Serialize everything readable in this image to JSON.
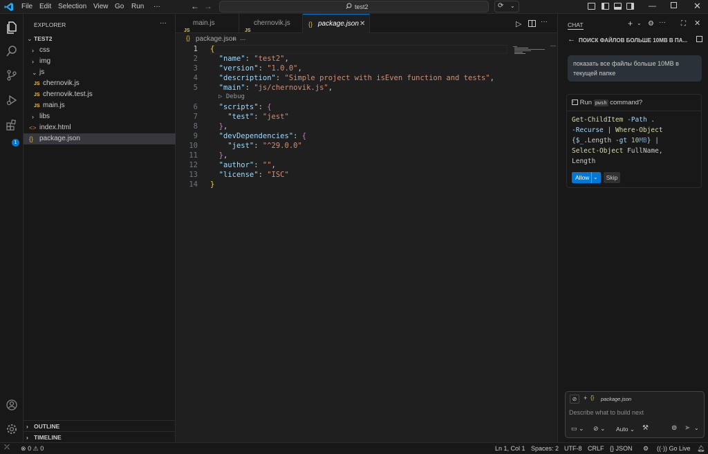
{
  "menu": [
    "File",
    "Edit",
    "Selection",
    "View",
    "Go",
    "Run",
    "···"
  ],
  "search": {
    "label": "test2"
  },
  "explorer": {
    "title": "EXPLORER",
    "folder": "TEST2",
    "items": [
      {
        "label": "css",
        "kind": "folder"
      },
      {
        "label": "img",
        "kind": "folder"
      },
      {
        "label": "js",
        "kind": "folder-open"
      },
      {
        "label": "chernovik.js",
        "kind": "js"
      },
      {
        "label": "chernovik.test.js",
        "kind": "js"
      },
      {
        "label": "main.js",
        "kind": "js"
      },
      {
        "label": "libs",
        "kind": "folder"
      },
      {
        "label": "index.html",
        "kind": "html"
      },
      {
        "label": "package.json",
        "kind": "json",
        "selected": true
      }
    ],
    "outline": "OUTLINE",
    "timeline": "TIMELINE"
  },
  "tabs": [
    {
      "label": "main.js",
      "icon": "JS"
    },
    {
      "label": "chernovik.js",
      "icon": "JS"
    },
    {
      "label": "package.json",
      "icon": "{}",
      "active": true
    }
  ],
  "breadcrumb": {
    "file": "package.json",
    "rest": "..."
  },
  "editor": {
    "debug_lens": "Debug",
    "lines": [
      {
        "n": "1",
        "t": "{"
      },
      {
        "n": "2",
        "t": "  \"name\": \"test2\","
      },
      {
        "n": "3",
        "t": "  \"version\": \"1.0.0\","
      },
      {
        "n": "4",
        "t": "  \"description\": \"Simple project with isEven function and tests\","
      },
      {
        "n": "5",
        "t": "  \"main\": \"js/chernovik.js\","
      },
      {
        "n": "6",
        "t": "  \"scripts\": {"
      },
      {
        "n": "7",
        "t": "    \"test\": \"jest\""
      },
      {
        "n": "8",
        "t": "  },"
      },
      {
        "n": "9",
        "t": "  \"devDependencies\": {"
      },
      {
        "n": "10",
        "t": "    \"jest\": \"^29.0.0\""
      },
      {
        "n": "11",
        "t": "  },"
      },
      {
        "n": "12",
        "t": "  \"author\": \"\","
      },
      {
        "n": "13",
        "t": "  \"license\": \"ISC\""
      },
      {
        "n": "14",
        "t": "}"
      }
    ]
  },
  "chat": {
    "title": "CHAT",
    "conversation": "ПОИСК ФАЙЛОВ БОЛЬШЕ 10MB В ПА...",
    "user_message": "показать все файлы больше 10MB в текущей папке",
    "run_prefix": "Run",
    "run_shell": "pwsh",
    "run_suffix": "command?",
    "allow_label": "Allow",
    "skip_label": "Skip",
    "context_file": "package.json",
    "input_placeholder": "Describe what to build next",
    "mode_label": "Auto"
  },
  "status": {
    "errors": "0",
    "warnings": "0",
    "position": "Ln 1, Col 1",
    "spaces": "Spaces: 2",
    "encoding": "UTF-8",
    "eol": "CRLF",
    "language": "JSON",
    "golive": "Go Live"
  },
  "badge_count": "1"
}
